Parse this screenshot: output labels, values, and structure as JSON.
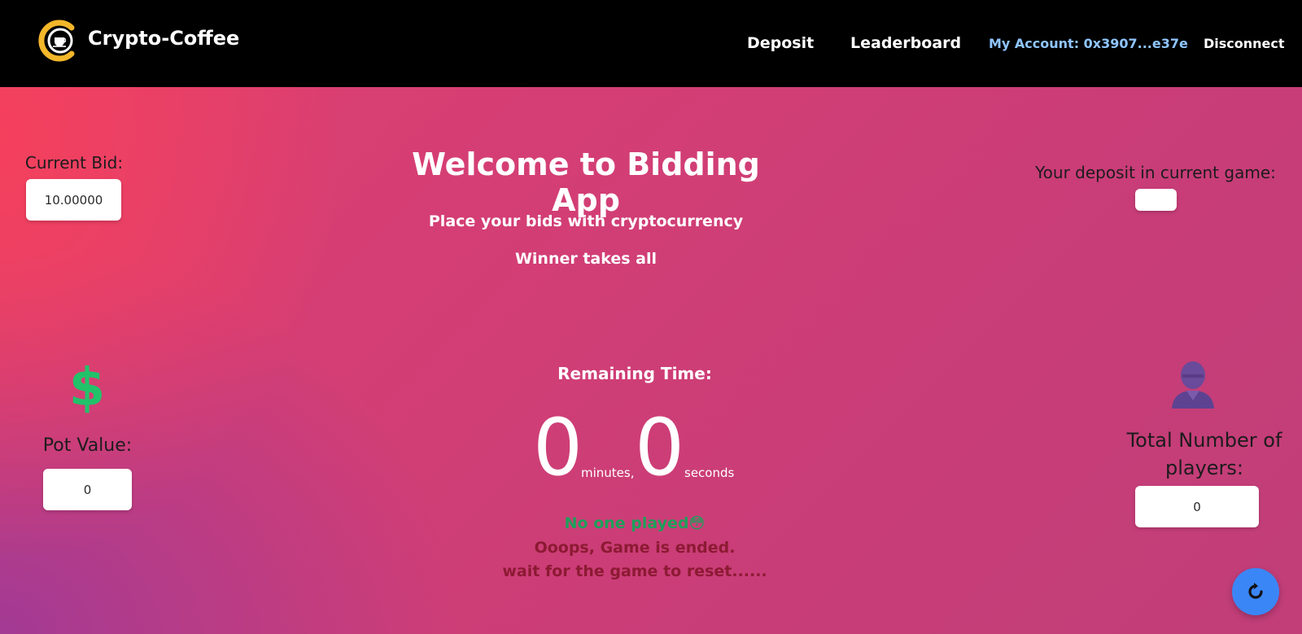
{
  "header": {
    "brand": "Crypto-Coffee",
    "nav": {
      "deposit": "Deposit",
      "leaderboard": "Leaderboard",
      "account": "My Account: 0x3907...e37e",
      "disconnect": "Disconnect"
    }
  },
  "main": {
    "title": "Welcome to Bidding App",
    "subtitle1": "Place your bids with cryptocurrency",
    "subtitle2": "Winner takes all"
  },
  "left": {
    "current_bid_label": "Current Bid:",
    "current_bid_value": "10.00000",
    "pot_icon": "$",
    "pot_label": "Pot Value:",
    "pot_value": "0"
  },
  "right": {
    "deposit_label": "Your deposit in current game:",
    "deposit_value": "",
    "players_label": "Total Number of players:",
    "players_value": "0"
  },
  "timer": {
    "label": "Remaining Time:",
    "minutes": "0",
    "minutes_unit": "minutes,",
    "seconds": "0",
    "seconds_unit": "seconds"
  },
  "status": {
    "no_one": "No one played",
    "emoji": "😳",
    "ended": "Ooops, Game is ended.",
    "reset": "wait for the game to reset......"
  },
  "icons": {
    "logo": "coffee-cup-icon",
    "pot": "dollar-sign-icon",
    "players": "user-icon",
    "fab": "refresh-icon"
  },
  "colors": {
    "header_bg": "#000000",
    "account_link": "#8fc5ff",
    "dollar": "#22c26a",
    "no_one": "#1ea05a",
    "ended": "#8c1a33",
    "fab": "#3b86f6"
  }
}
